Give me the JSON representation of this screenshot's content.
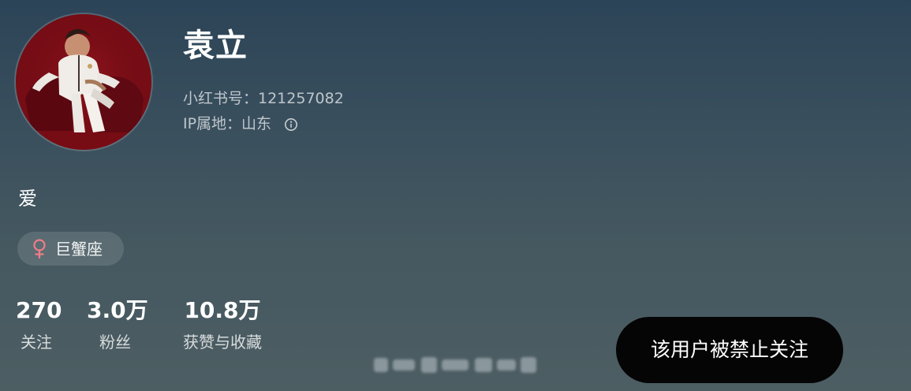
{
  "profile": {
    "nickname": "袁立",
    "red_id": "小红书号：121257082",
    "ip_location": "IP属地：山东",
    "bio": "爱",
    "zodiac_tag": "巨蟹座",
    "gender_icon": "female-icon",
    "info_icon": "info-icon",
    "avatar_icon": "profile-avatar"
  },
  "stats": [
    {
      "value": "270",
      "label": "关注"
    },
    {
      "value": "3.0万",
      "label": "粉丝"
    },
    {
      "value": "10.8万",
      "label": "获赞与收藏"
    }
  ],
  "action": {
    "follow_status": "该用户被禁止关注"
  },
  "colors": {
    "background_top": "#2c4457",
    "background_bottom": "#4d5e63",
    "gender_accent": "#f07d88",
    "button_background": "#050505",
    "text_primary": "#ffffff"
  }
}
